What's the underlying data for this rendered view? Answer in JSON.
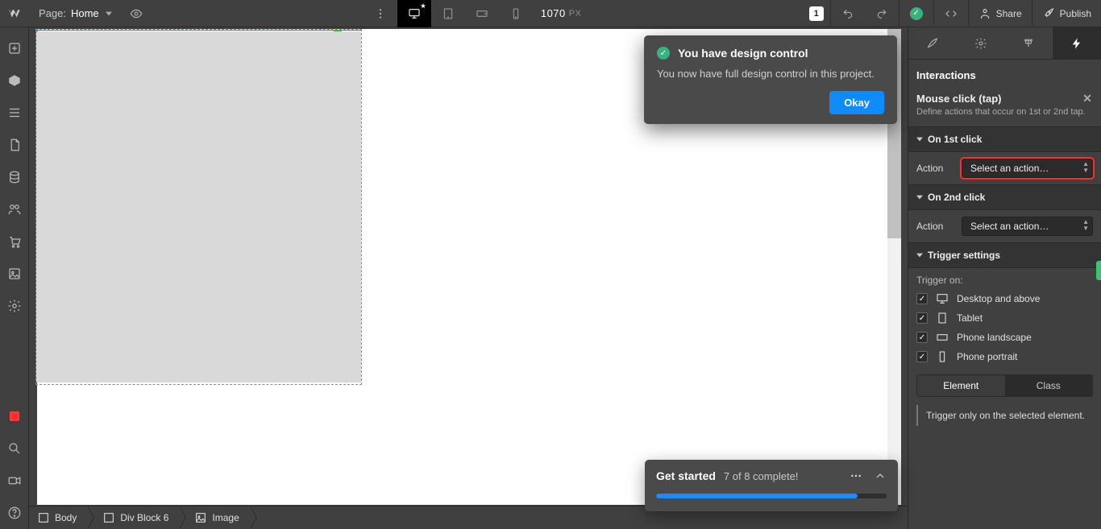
{
  "topbar": {
    "page_label": "Page:",
    "page_name": "Home",
    "width_px": "1070",
    "px_unit": "PX",
    "users_count": "1",
    "share_label": "Share",
    "publish_label": "Publish"
  },
  "breadcrumb": [
    {
      "label": "Body"
    },
    {
      "label": "Div Block 6"
    },
    {
      "label": "Image"
    }
  ],
  "toast": {
    "title": "You have design control",
    "body": "You now have full design control in this project.",
    "okay": "Okay"
  },
  "getstarted": {
    "title": "Get started",
    "progress": "7 of 8 complete!",
    "pct": 87.5
  },
  "panel": {
    "title": "Interactions",
    "trigger_name": "Mouse click (tap)",
    "trigger_desc": "Define actions that occur on 1st or 2nd tap.",
    "sections": {
      "on_first": "On 1st click",
      "on_second": "On 2nd click",
      "settings": "Trigger settings"
    },
    "action_label": "Action",
    "action_placeholder": "Select an action…",
    "trigger_on_label": "Trigger on:",
    "breakpoints": [
      "Desktop and above",
      "Tablet",
      "Phone landscape",
      "Phone portrait"
    ],
    "seg": {
      "element": "Element",
      "class": "Class"
    },
    "note": "Trigger only on the selected element."
  }
}
